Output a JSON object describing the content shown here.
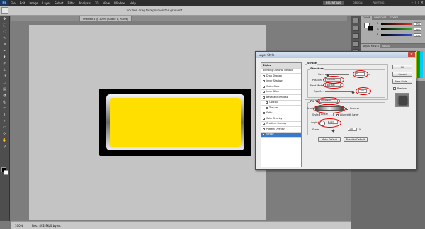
{
  "menubar": {
    "logo": "Ps",
    "items": [
      "File",
      "Edit",
      "Image",
      "Layer",
      "Select",
      "Filter",
      "Analysis",
      "3D",
      "View",
      "Window",
      "Help"
    ],
    "workspaces": [
      "ESSENTIALS",
      "DESIGN",
      "PAINTING"
    ],
    "window_controls": [
      "–",
      "□",
      "×"
    ]
  },
  "options_bar": {
    "hint": "Click and drag to reposition the gradient."
  },
  "document_tab": {
    "title": "Untitled-1 @ 100% (Shape 1, RGB/8)"
  },
  "status_bar": {
    "zoom": "100%",
    "doc_info": "Doc: 492.9K/0 bytes"
  },
  "color_panel": {
    "tabs": [
      "COLOR",
      "SWATCHES",
      "STYLES"
    ],
    "channels": [
      {
        "name": "R",
        "value": "255",
        "color": "#e03030"
      },
      {
        "name": "G",
        "value": "255",
        "color": "#30b030"
      },
      {
        "name": "B",
        "value": "255",
        "color": "#3050e0"
      }
    ]
  },
  "swatches_panel": {
    "tabs": [
      "ADJUSTMENTS",
      "MASKS"
    ]
  },
  "dialog": {
    "title": "Layer Style",
    "close": "×",
    "styles_list": {
      "header": "Styles",
      "items": [
        {
          "label": "Blending Options: Default",
          "checkbox": false,
          "sub": false,
          "selected": false
        },
        {
          "label": "Drop Shadow",
          "checkbox": true,
          "sub": false,
          "selected": false
        },
        {
          "label": "Inner Shadow",
          "checkbox": true,
          "sub": false,
          "selected": false
        },
        {
          "label": "Outer Glow",
          "checkbox": true,
          "sub": false,
          "selected": false
        },
        {
          "label": "Inner Glow",
          "checkbox": true,
          "sub": false,
          "selected": false
        },
        {
          "label": "Bevel and Emboss",
          "checkbox": true,
          "sub": false,
          "selected": false
        },
        {
          "label": "Contour",
          "checkbox": true,
          "sub": true,
          "selected": false
        },
        {
          "label": "Texture",
          "checkbox": true,
          "sub": true,
          "selected": false
        },
        {
          "label": "Satin",
          "checkbox": true,
          "sub": false,
          "selected": false
        },
        {
          "label": "Color Overlay",
          "checkbox": true,
          "sub": false,
          "selected": false
        },
        {
          "label": "Gradient Overlay",
          "checkbox": true,
          "sub": false,
          "selected": false
        },
        {
          "label": "Pattern Overlay",
          "checkbox": true,
          "sub": false,
          "selected": false
        },
        {
          "label": "Stroke",
          "checkbox": true,
          "sub": false,
          "selected": true
        }
      ]
    },
    "stroke": {
      "section_title": "Stroke",
      "structure_title": "Structure",
      "size_label": "Size:",
      "size_value": "6",
      "size_unit": "px",
      "position_label": "Position:",
      "position_value": "Outside",
      "blend_label": "Blend Mode:",
      "blend_value": "Normal",
      "opacity_label": "Opacity:",
      "opacity_value": "100",
      "opacity_unit": "%",
      "fill_title": "Fill Type",
      "fill_type_value": "Gradient",
      "gradient_label": "Gradient:",
      "reverse_label": "Reverse",
      "style_label": "Style:",
      "style_value": "Linear",
      "align_label": "Align with Layer",
      "angle_label": "Angle:",
      "angle_value": "145",
      "angle_unit": "°",
      "scale_label": "Scale:",
      "scale_value": "100",
      "scale_unit": "%",
      "make_default": "Make Default",
      "reset_default": "Reset to Default"
    },
    "buttons": {
      "ok": "OK",
      "cancel": "Cancel",
      "new_style": "New Style...",
      "preview": "Preview"
    }
  }
}
